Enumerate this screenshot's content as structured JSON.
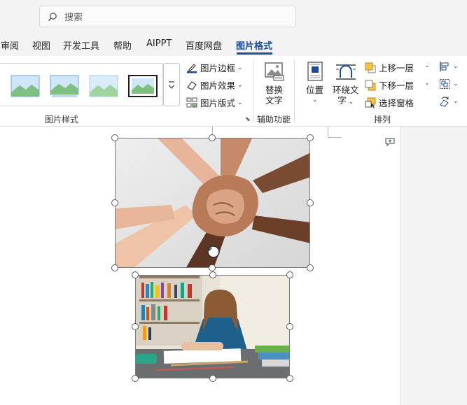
{
  "search": {
    "placeholder": "搜索",
    "icon": "search-icon"
  },
  "tabs": [
    {
      "label": "审阅"
    },
    {
      "label": "视图"
    },
    {
      "label": "开发工具"
    },
    {
      "label": "帮助"
    },
    {
      "label": "AIPPT"
    },
    {
      "label": "百度网盘"
    },
    {
      "label": "图片格式",
      "active": true
    }
  ],
  "ribbon": {
    "picture_styles": {
      "label": "图片样式",
      "border": "图片边框",
      "effects": "图片效果",
      "layout": "图片版式"
    },
    "accessibility": {
      "label": "辅助功能",
      "alt_text_line1": "替换",
      "alt_text_line2": "文字"
    },
    "arrange": {
      "label": "排列",
      "position": "位置",
      "wrap_text_line1": "环绕文",
      "wrap_text_line2": "字",
      "bring_forward": "上移一层",
      "send_backward": "下移一层",
      "selection_pane": "选择窗格"
    }
  },
  "colors": {
    "accent": "#1a4c9c",
    "chrome": "#f3f3f3"
  }
}
